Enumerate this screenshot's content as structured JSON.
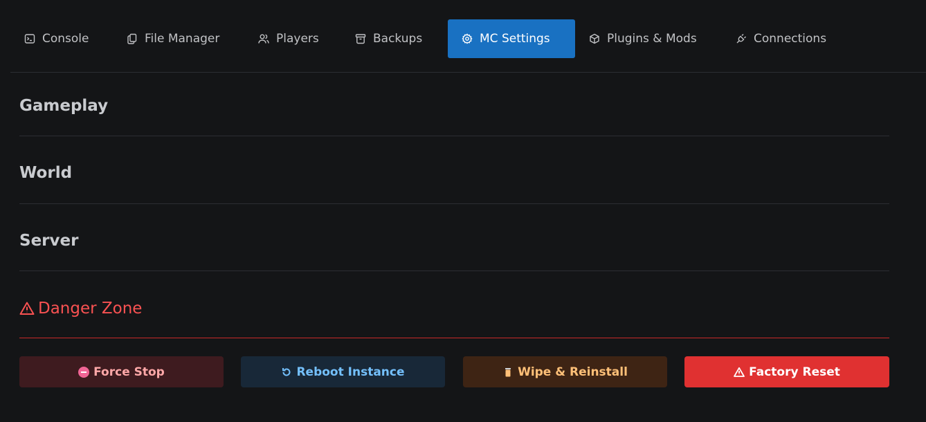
{
  "tabs": [
    {
      "label": "Console",
      "icon": "terminal-icon"
    },
    {
      "label": "File Manager",
      "icon": "files-icon"
    },
    {
      "label": "Players",
      "icon": "users-icon"
    },
    {
      "label": "Backups",
      "icon": "archive-icon"
    },
    {
      "label": "MC Settings",
      "icon": "gear-icon",
      "active": true
    },
    {
      "label": "Plugins & Mods",
      "icon": "package-icon"
    },
    {
      "label": "Connections",
      "icon": "plug-icon"
    }
  ],
  "sections": {
    "gameplay": "Gameplay",
    "world": "World",
    "server": "Server",
    "danger": "Danger Zone"
  },
  "actions": {
    "force_stop": "Force Stop",
    "reboot": "Reboot Instance",
    "wipe": "Wipe & Reinstall",
    "factory_reset": "Factory Reset"
  },
  "colors": {
    "background": "#141517",
    "accent": "#1971c2",
    "danger": "#fa5252",
    "danger_button": "#e03131"
  }
}
